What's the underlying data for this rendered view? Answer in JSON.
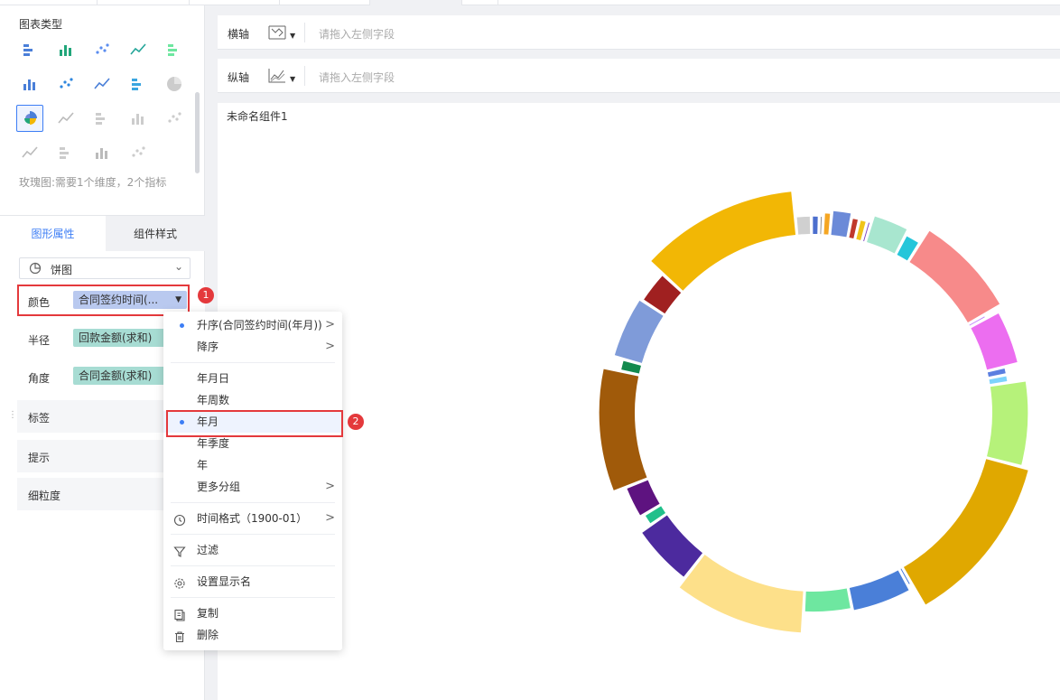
{
  "left_panel": {
    "chart_types_title": "图表类型",
    "chart_type_icons": [
      "grouped-bar-icon",
      "stacked-bar-icon",
      "area-stream-icon",
      "line-icon",
      "radar-icon",
      "area-line-icon",
      "column-icon",
      "scatter-icon",
      "bubble-icon",
      "pie-icon",
      "rose-icon",
      "map-icon",
      "point-map-icon",
      "flow-map-icon",
      "heat-map-icon",
      "matrix-icon",
      "word-cloud-icon",
      "funnel-icon",
      "gauge-icon"
    ],
    "selected_chart_type": "rose-icon",
    "hint": "玫瑰图:需要1个维度，2个指标",
    "tabs": [
      "图形属性",
      "组件样式"
    ],
    "active_tab": "图形属性",
    "pie_select": "饼图",
    "props": [
      {
        "label": "颜色",
        "field": "合同签约时间(..."
      },
      {
        "label": "半径",
        "field": "回款金额(求和)"
      },
      {
        "label": "角度",
        "field": "合同金额(求和)"
      },
      {
        "label": "标签",
        "field": ""
      },
      {
        "label": "提示",
        "field": ""
      },
      {
        "label": "细粒度",
        "field": ""
      }
    ]
  },
  "axes": {
    "x_label": "横轴",
    "y_label": "纵轴",
    "placeholder": "请拖入左侧字段"
  },
  "component": {
    "title": "未命名组件1"
  },
  "menu": {
    "sort_asc": "升序(合同签约时间(年月))",
    "sort_desc": "降序",
    "ymd": "年月日",
    "yweek": "年周数",
    "ym": "年月",
    "yq": "年季度",
    "y": "年",
    "more": "更多分组",
    "time_format": "时间格式（1900-01）",
    "filter": "过滤",
    "set_display_name": "设置显示名",
    "copy": "复制",
    "delete": "删除"
  },
  "annotations": [
    "1",
    "2"
  ],
  "colors": {
    "accent": "#3d7ef5",
    "annotation_red": "#e4393c"
  },
  "chart_data": {
    "type": "pie",
    "variant": "rose-ring",
    "slices": [
      {
        "color": "#f5a623",
        "angle": 2,
        "radius": 0.48
      },
      {
        "color": "#6b8ad8",
        "angle": 5,
        "radius": 0.55
      },
      {
        "color": "#c0392b",
        "angle": 2,
        "radius": 0.44
      },
      {
        "color": "#f0c419",
        "angle": 2,
        "radius": 0.44
      },
      {
        "color": "#7b3fbf",
        "angle": 1,
        "radius": 0.44
      },
      {
        "color": "#a8e6cf",
        "angle": 9,
        "radius": 0.62
      },
      {
        "color": "#26c6da",
        "angle": 4,
        "radius": 0.48
      },
      {
        "color": "#f78a8a",
        "angle": 24,
        "radius": 0.85
      },
      {
        "color": "#c084fc",
        "angle": 1,
        "radius": 0.4
      },
      {
        "color": "#ec6ef0",
        "angle": 13,
        "radius": 0.72
      },
      {
        "color": "#5b7fe0",
        "angle": 2,
        "radius": 0.4
      },
      {
        "color": "#7dd3fc",
        "angle": 2,
        "radius": 0.4
      },
      {
        "color": "#b6f27a",
        "angle": 20,
        "radius": 0.82
      },
      {
        "color": "#e0a800",
        "angle": 39,
        "radius": 1.0
      },
      {
        "color": "#3a6fd8",
        "angle": 1,
        "radius": 0.4
      },
      {
        "color": "#4a7fd8",
        "angle": 15,
        "radius": 0.52
      },
      {
        "color": "#6ee7a0",
        "angle": 12,
        "radius": 0.46
      },
      {
        "color": "#fde08a",
        "angle": 30,
        "radius": 0.95
      },
      {
        "color": "#4c2a9e",
        "angle": 15,
        "radius": 0.7
      },
      {
        "color": "#21c08b",
        "angle": 3,
        "radius": 0.42
      },
      {
        "color": "#5e1380",
        "angle": 8,
        "radius": 0.52
      },
      {
        "color": "#a05a0a",
        "angle": 29,
        "radius": 0.82
      },
      {
        "color": "#138a4e",
        "angle": 3,
        "radius": 0.42
      },
      {
        "color": "#7f9bd9",
        "angle": 15,
        "radius": 0.65
      },
      {
        "color": "#a02020",
        "angle": 8,
        "radius": 0.58
      },
      {
        "color": "#f2b705",
        "angle": 36,
        "radius": 1.0
      },
      {
        "color": "#d0d0d0",
        "angle": 4,
        "radius": 0.4
      },
      {
        "color": "#4c6fce",
        "angle": 2,
        "radius": 0.4
      },
      {
        "color": "#8a8a8a",
        "angle": 1,
        "radius": 0.4
      }
    ]
  }
}
